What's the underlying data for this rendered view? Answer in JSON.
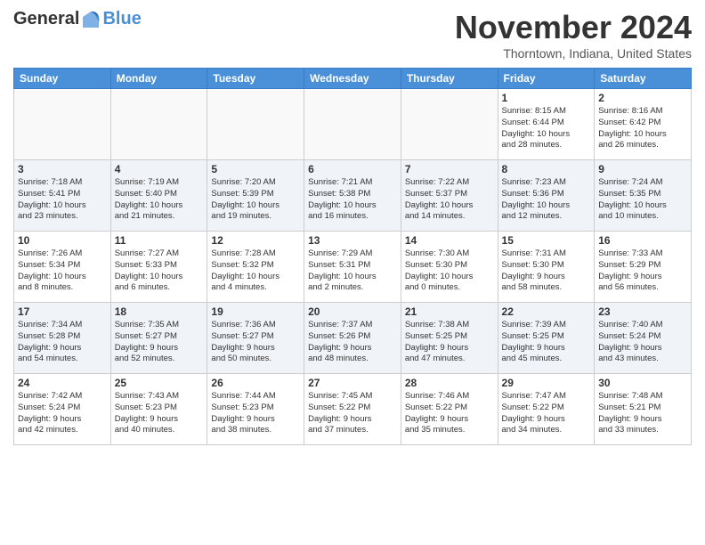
{
  "header": {
    "logo_general": "General",
    "logo_blue": "Blue",
    "title": "November 2024",
    "location": "Thorntown, Indiana, United States"
  },
  "weekdays": [
    "Sunday",
    "Monday",
    "Tuesday",
    "Wednesday",
    "Thursday",
    "Friday",
    "Saturday"
  ],
  "weeks": [
    [
      {
        "day": "",
        "info": ""
      },
      {
        "day": "",
        "info": ""
      },
      {
        "day": "",
        "info": ""
      },
      {
        "day": "",
        "info": ""
      },
      {
        "day": "",
        "info": ""
      },
      {
        "day": "1",
        "info": "Sunrise: 8:15 AM\nSunset: 6:44 PM\nDaylight: 10 hours\nand 28 minutes."
      },
      {
        "day": "2",
        "info": "Sunrise: 8:16 AM\nSunset: 6:42 PM\nDaylight: 10 hours\nand 26 minutes."
      }
    ],
    [
      {
        "day": "3",
        "info": "Sunrise: 7:18 AM\nSunset: 5:41 PM\nDaylight: 10 hours\nand 23 minutes."
      },
      {
        "day": "4",
        "info": "Sunrise: 7:19 AM\nSunset: 5:40 PM\nDaylight: 10 hours\nand 21 minutes."
      },
      {
        "day": "5",
        "info": "Sunrise: 7:20 AM\nSunset: 5:39 PM\nDaylight: 10 hours\nand 19 minutes."
      },
      {
        "day": "6",
        "info": "Sunrise: 7:21 AM\nSunset: 5:38 PM\nDaylight: 10 hours\nand 16 minutes."
      },
      {
        "day": "7",
        "info": "Sunrise: 7:22 AM\nSunset: 5:37 PM\nDaylight: 10 hours\nand 14 minutes."
      },
      {
        "day": "8",
        "info": "Sunrise: 7:23 AM\nSunset: 5:36 PM\nDaylight: 10 hours\nand 12 minutes."
      },
      {
        "day": "9",
        "info": "Sunrise: 7:24 AM\nSunset: 5:35 PM\nDaylight: 10 hours\nand 10 minutes."
      }
    ],
    [
      {
        "day": "10",
        "info": "Sunrise: 7:26 AM\nSunset: 5:34 PM\nDaylight: 10 hours\nand 8 minutes."
      },
      {
        "day": "11",
        "info": "Sunrise: 7:27 AM\nSunset: 5:33 PM\nDaylight: 10 hours\nand 6 minutes."
      },
      {
        "day": "12",
        "info": "Sunrise: 7:28 AM\nSunset: 5:32 PM\nDaylight: 10 hours\nand 4 minutes."
      },
      {
        "day": "13",
        "info": "Sunrise: 7:29 AM\nSunset: 5:31 PM\nDaylight: 10 hours\nand 2 minutes."
      },
      {
        "day": "14",
        "info": "Sunrise: 7:30 AM\nSunset: 5:30 PM\nDaylight: 10 hours\nand 0 minutes."
      },
      {
        "day": "15",
        "info": "Sunrise: 7:31 AM\nSunset: 5:30 PM\nDaylight: 9 hours\nand 58 minutes."
      },
      {
        "day": "16",
        "info": "Sunrise: 7:33 AM\nSunset: 5:29 PM\nDaylight: 9 hours\nand 56 minutes."
      }
    ],
    [
      {
        "day": "17",
        "info": "Sunrise: 7:34 AM\nSunset: 5:28 PM\nDaylight: 9 hours\nand 54 minutes."
      },
      {
        "day": "18",
        "info": "Sunrise: 7:35 AM\nSunset: 5:27 PM\nDaylight: 9 hours\nand 52 minutes."
      },
      {
        "day": "19",
        "info": "Sunrise: 7:36 AM\nSunset: 5:27 PM\nDaylight: 9 hours\nand 50 minutes."
      },
      {
        "day": "20",
        "info": "Sunrise: 7:37 AM\nSunset: 5:26 PM\nDaylight: 9 hours\nand 48 minutes."
      },
      {
        "day": "21",
        "info": "Sunrise: 7:38 AM\nSunset: 5:25 PM\nDaylight: 9 hours\nand 47 minutes."
      },
      {
        "day": "22",
        "info": "Sunrise: 7:39 AM\nSunset: 5:25 PM\nDaylight: 9 hours\nand 45 minutes."
      },
      {
        "day": "23",
        "info": "Sunrise: 7:40 AM\nSunset: 5:24 PM\nDaylight: 9 hours\nand 43 minutes."
      }
    ],
    [
      {
        "day": "24",
        "info": "Sunrise: 7:42 AM\nSunset: 5:24 PM\nDaylight: 9 hours\nand 42 minutes."
      },
      {
        "day": "25",
        "info": "Sunrise: 7:43 AM\nSunset: 5:23 PM\nDaylight: 9 hours\nand 40 minutes."
      },
      {
        "day": "26",
        "info": "Sunrise: 7:44 AM\nSunset: 5:23 PM\nDaylight: 9 hours\nand 38 minutes."
      },
      {
        "day": "27",
        "info": "Sunrise: 7:45 AM\nSunset: 5:22 PM\nDaylight: 9 hours\nand 37 minutes."
      },
      {
        "day": "28",
        "info": "Sunrise: 7:46 AM\nSunset: 5:22 PM\nDaylight: 9 hours\nand 35 minutes."
      },
      {
        "day": "29",
        "info": "Sunrise: 7:47 AM\nSunset: 5:22 PM\nDaylight: 9 hours\nand 34 minutes."
      },
      {
        "day": "30",
        "info": "Sunrise: 7:48 AM\nSunset: 5:21 PM\nDaylight: 9 hours\nand 33 minutes."
      }
    ]
  ]
}
